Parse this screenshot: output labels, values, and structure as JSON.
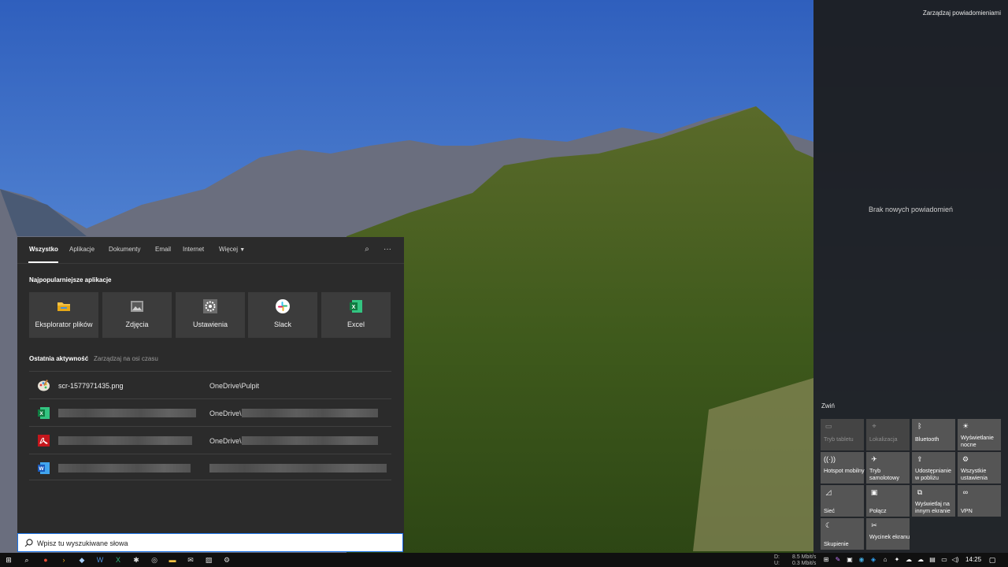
{
  "search": {
    "tabs": [
      "Wszystko",
      "Aplikacje",
      "Dokumenty",
      "Email",
      "Internet",
      "Więcej"
    ],
    "top_apps_title": "Najpopularniejsze aplikacje",
    "top_apps": [
      {
        "label": "Eksplorator plików",
        "icon": "folder-icon"
      },
      {
        "label": "Zdjęcia",
        "icon": "photos-icon"
      },
      {
        "label": "Ustawienia",
        "icon": "gear-icon"
      },
      {
        "label": "Slack",
        "icon": "slack-icon"
      },
      {
        "label": "Excel",
        "icon": "excel-icon"
      }
    ],
    "recent_title": "Ostatnia aktywność",
    "recent_manage": "Zarządzaj na osi czasu",
    "recent": [
      {
        "name": "scr-1577971435.png",
        "path": "OneDrive\\Pulpit",
        "icon": "paint-icon"
      },
      {
        "name": "",
        "path": "OneDrive\\",
        "icon": "excel-icon"
      },
      {
        "name": "",
        "path": "OneDrive\\",
        "icon": "pdf-icon"
      },
      {
        "name": "",
        "path": "",
        "icon": "word-icon"
      }
    ],
    "placeholder": "Wpisz tu wyszukiwane słowa"
  },
  "action_center": {
    "manage": "Zarządzaj powiadomieniami",
    "empty": "Brak nowych powiadomień",
    "collapse": "Zwiń",
    "tiles": [
      {
        "label": "Tryb tabletu",
        "icon": "tablet-icon",
        "state": "off"
      },
      {
        "label": "Lokalizacja",
        "icon": "location-icon",
        "state": "off"
      },
      {
        "label": "Bluetooth",
        "icon": "bluetooth-icon",
        "state": "on"
      },
      {
        "label": "Wyświetlanie nocne",
        "icon": "night-light-icon",
        "state": "on"
      },
      {
        "label": "Hotspot mobilny",
        "icon": "hotspot-icon",
        "state": "on"
      },
      {
        "label": "Tryb samolotowy",
        "icon": "airplane-icon",
        "state": "on"
      },
      {
        "label": "Udostępnianie w pobliżu",
        "icon": "nearby-share-icon",
        "state": "on"
      },
      {
        "label": "Wszystkie ustawienia",
        "icon": "settings-icon",
        "state": "on"
      },
      {
        "label": "Sieć",
        "icon": "network-icon",
        "state": "on"
      },
      {
        "label": "Połącz",
        "icon": "connect-icon",
        "state": "on"
      },
      {
        "label": "Wyświetlaj na innym ekranie",
        "icon": "project-icon",
        "state": "on"
      },
      {
        "label": "VPN",
        "icon": "vpn-icon",
        "state": "on"
      },
      {
        "label": "Skupienie",
        "icon": "focus-assist-icon",
        "state": "on"
      },
      {
        "label": "Wycinek ekranu",
        "icon": "snip-icon",
        "state": "on"
      }
    ]
  },
  "taskbar": {
    "net_down_label": "D:",
    "net_up_label": "U:",
    "net_down": "8.5 Mbit/s",
    "net_up": "0.3 Mbit/s",
    "time": "14:25"
  }
}
